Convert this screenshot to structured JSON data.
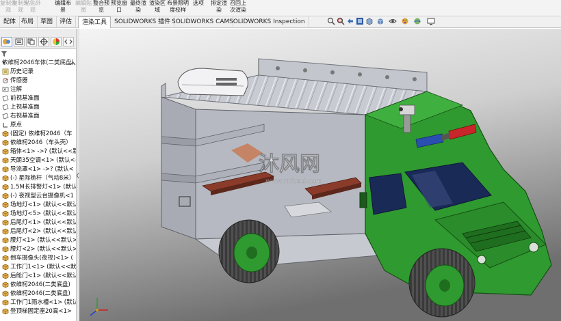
{
  "ribbon": {
    "items": [
      {
        "l1": "复制外",
        "l2": "观",
        "state": "dis"
      },
      {
        "l1": "复制外",
        "l2": "观",
        "state": "dis"
      },
      {
        "l1": "粘贴外",
        "l2": "观",
        "state": "dis"
      },
      {
        "l1": "编辑布",
        "l2": "景",
        "state": "en"
      },
      {
        "l1": "编辑贴",
        "l2": "图",
        "state": "dis"
      },
      {
        "l1": "整合预",
        "l2": "览",
        "state": "en"
      },
      {
        "l1": "预览窗",
        "l2": "口",
        "state": "en"
      },
      {
        "l1": "最终渲",
        "l2": "染",
        "state": "en"
      },
      {
        "l1": "渲染区",
        "l2": "域",
        "state": "en"
      },
      {
        "l1": "布景照明",
        "l2": "度校样",
        "state": "en"
      },
      {
        "l1": "选项",
        "l2": "",
        "state": "en"
      },
      {
        "l1": "排定渲",
        "l2": "染",
        "state": "en"
      },
      {
        "l1": "召回上",
        "l2": "次渲染",
        "state": "en"
      }
    ]
  },
  "tabs": [
    "配体",
    "布局",
    "草图",
    "评估",
    "渲染工具",
    "SOLIDWORKS 插件",
    "SOLIDWORKS CAM",
    "SOLIDWORKS Inspection"
  ],
  "active_tab": "渲染工具",
  "tree": {
    "root": "依维柯2046车体(二类底盘)",
    "items": [
      {
        "label": "历史记录",
        "icon": "history-icon"
      },
      {
        "label": "传感器",
        "icon": "sensor-icon"
      },
      {
        "label": "注解",
        "icon": "annotation-icon"
      },
      {
        "label": "前视基准面",
        "icon": "plane-icon"
      },
      {
        "label": "上视基准面",
        "icon": "plane-icon"
      },
      {
        "label": "右视基准面",
        "icon": "plane-icon"
      },
      {
        "label": "原点",
        "icon": "origin-icon"
      },
      {
        "label": "(固定) 依维柯2046（车",
        "icon": "part-icon"
      },
      {
        "label": "依维柯2046（车头壳）",
        "icon": "part-icon"
      },
      {
        "label": "箱体<1> ->? (默认<<默",
        "icon": "part-icon"
      },
      {
        "label": "天朗35空调<1> (默认<<",
        "icon": "part-icon"
      },
      {
        "label": "导流罩<1> ->? (默认<",
        "icon": "part-icon"
      },
      {
        "label": "(-) 星际桅杆（气动8米）",
        "icon": "part-icon"
      },
      {
        "label": "1.5M长排警灯<1> (默认",
        "icon": "part-icon"
      },
      {
        "label": "(-) 夜视型云台摄像机<1",
        "icon": "part-icon"
      },
      {
        "label": "场地灯<1> (默认<<默认",
        "icon": "part-icon"
      },
      {
        "label": "场地灯<5> (默认<<默认",
        "icon": "part-icon"
      },
      {
        "label": "后尾灯<1> (默认<<默认",
        "icon": "part-icon"
      },
      {
        "label": "后尾灯<2> (默认<<默认",
        "icon": "part-icon"
      },
      {
        "label": "腰灯<1> (默认<<默认>",
        "icon": "part-icon"
      },
      {
        "label": "腰灯<2> (默认<<默认>",
        "icon": "part-icon"
      },
      {
        "label": "倒车摄像头(夜视)<1> (",
        "icon": "part-icon"
      },
      {
        "label": "工作门1<1> (默认<<默",
        "icon": "part-icon"
      },
      {
        "label": "后舱门<1> (默认<<默认",
        "icon": "part-icon"
      },
      {
        "label": "依维柯2046(二类底盘)",
        "icon": "part-icon"
      },
      {
        "label": "依维柯2046(二类底盘)",
        "icon": "part-icon"
      },
      {
        "label": "工作门1雨水槽<1> (默认",
        "icon": "part-icon"
      },
      {
        "label": "登顶梯固定座20高<1>",
        "icon": "part-icon"
      }
    ]
  },
  "watermark": {
    "main": "沐风网",
    "url": "www.mfcad.com"
  },
  "colors": {
    "truck_green": "#2f9a2f",
    "box_gray": "#b9bcc4",
    "bench": "#8a3b2a",
    "bg_top": "#f4f4f4",
    "bg_bottom": "#6f6f6f"
  }
}
